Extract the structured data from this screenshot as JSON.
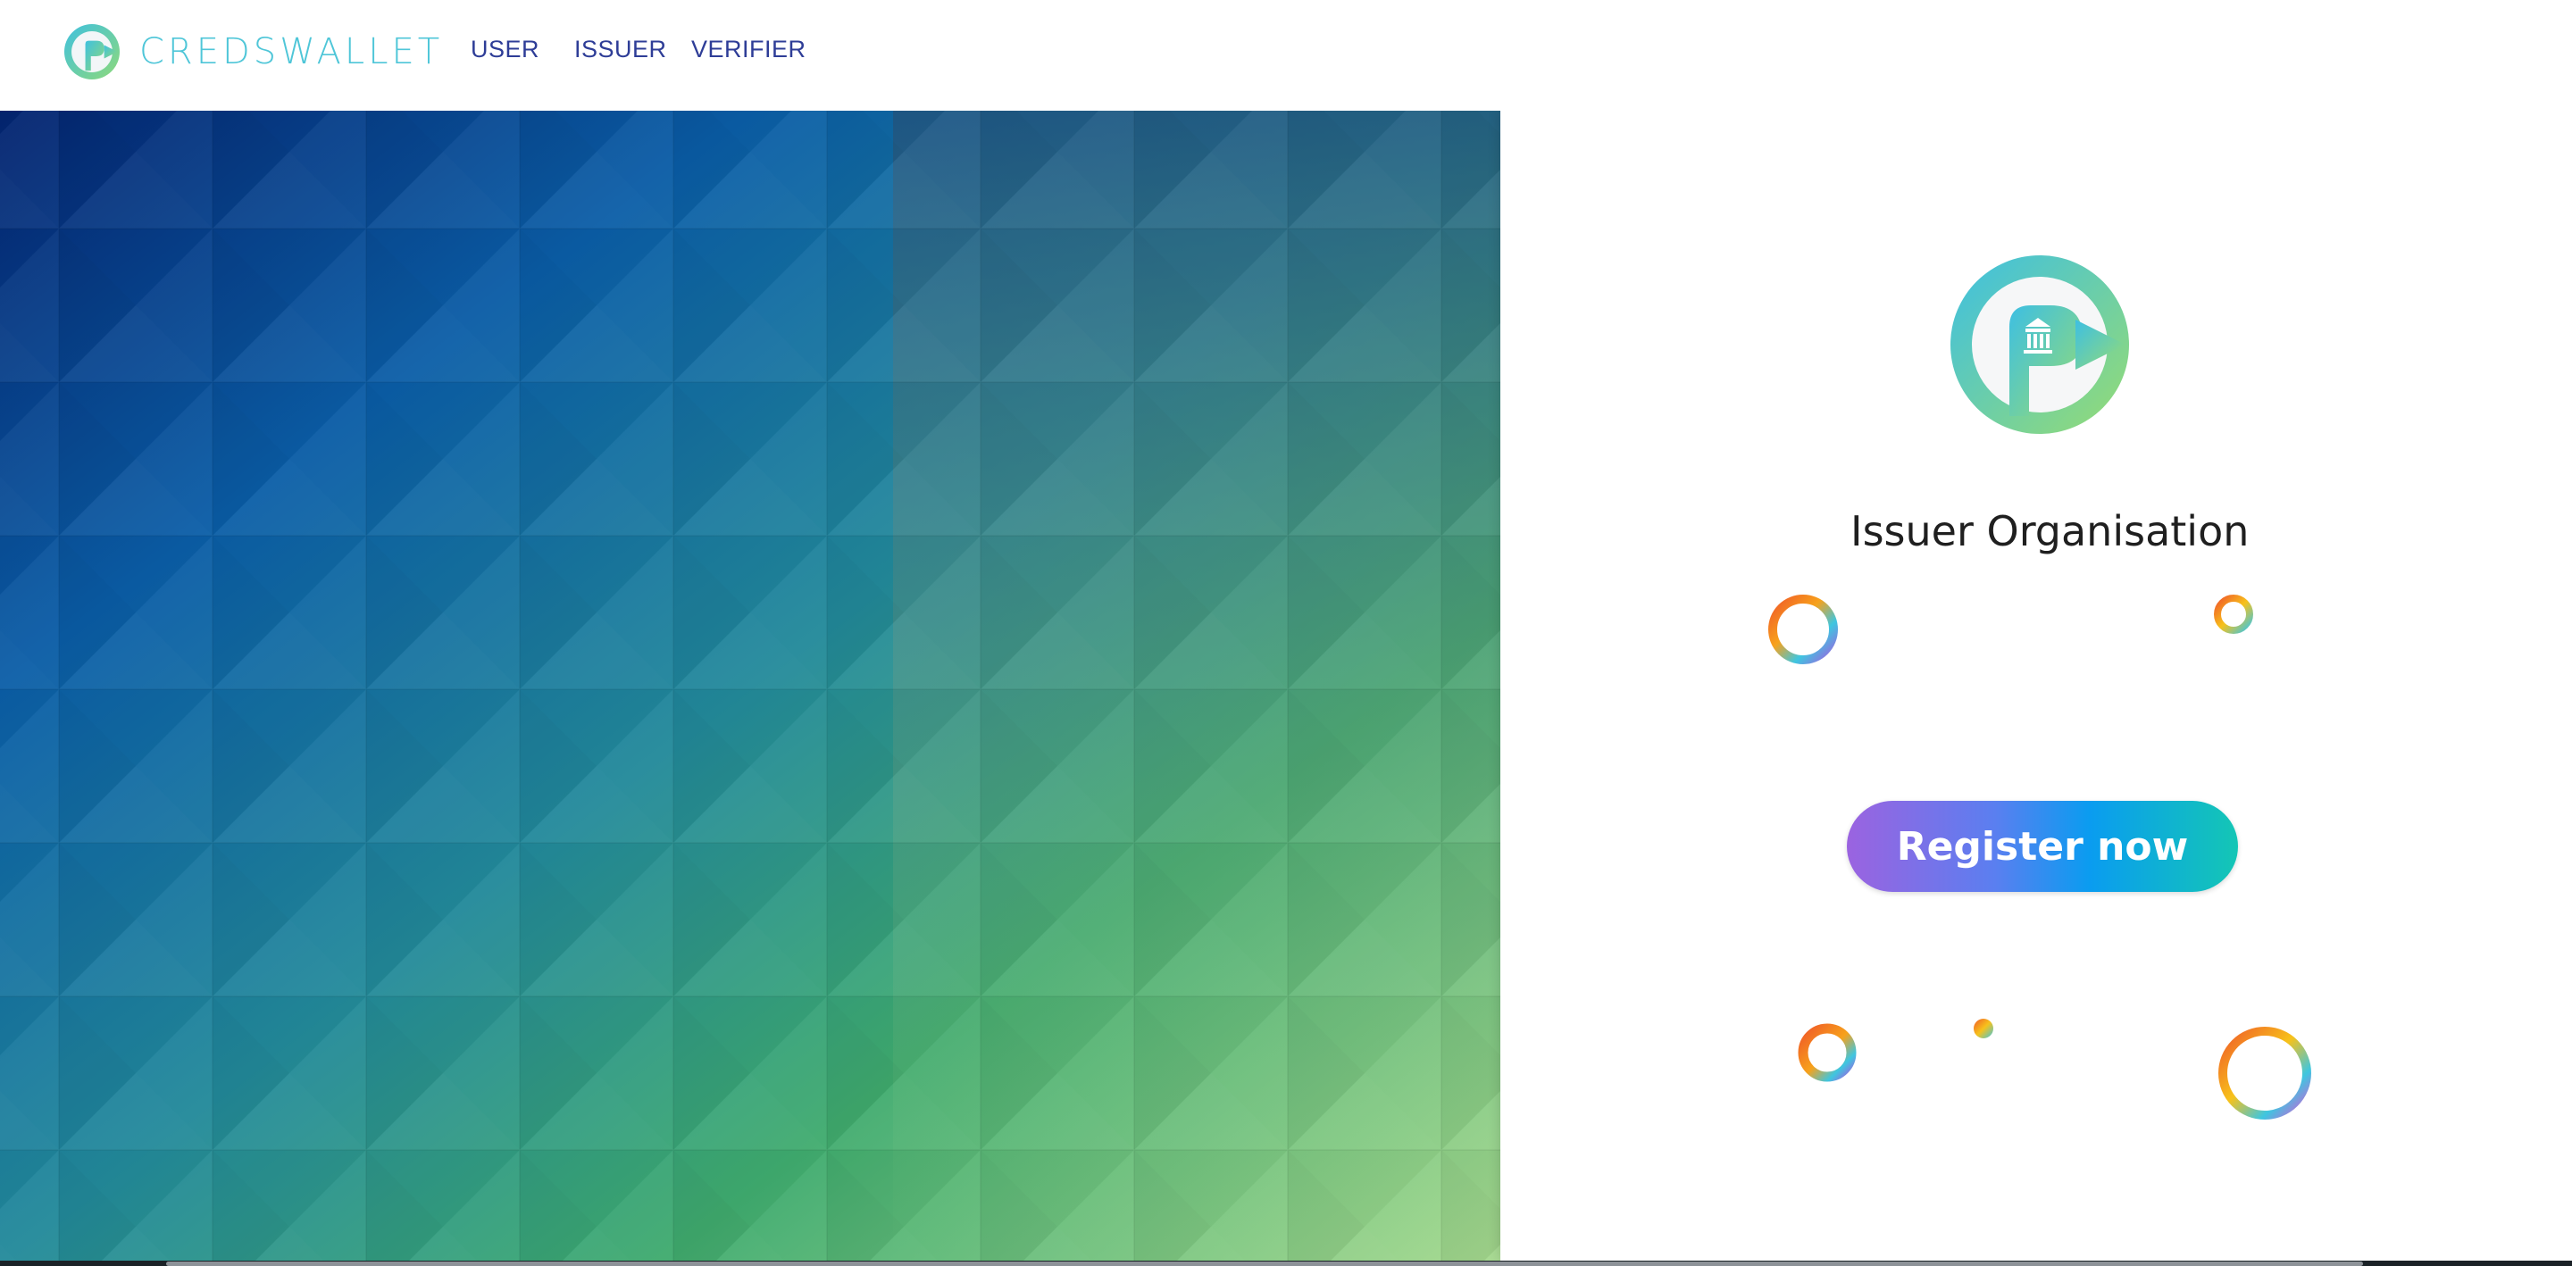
{
  "header": {
    "brand_name": "CREDSWALLET",
    "logo_icon": "credswallet-logo-icon",
    "nav": [
      {
        "label": "USER"
      },
      {
        "label": "ISSUER"
      },
      {
        "label": "VERIFIER"
      }
    ]
  },
  "panel": {
    "logo_icon": "issuer-bank-logo-icon",
    "title": "Issuer Organisation",
    "register_label": "Register now",
    "decorations": "rainbow-ring-icon"
  },
  "colors": {
    "brand_teal": "#4fc6d8",
    "nav_text": "#2e3d97",
    "hero_top": "#0a2d73",
    "hero_bottom": "#8fd080",
    "button_start": "#9b63e0",
    "button_end": "#14c6b5"
  }
}
